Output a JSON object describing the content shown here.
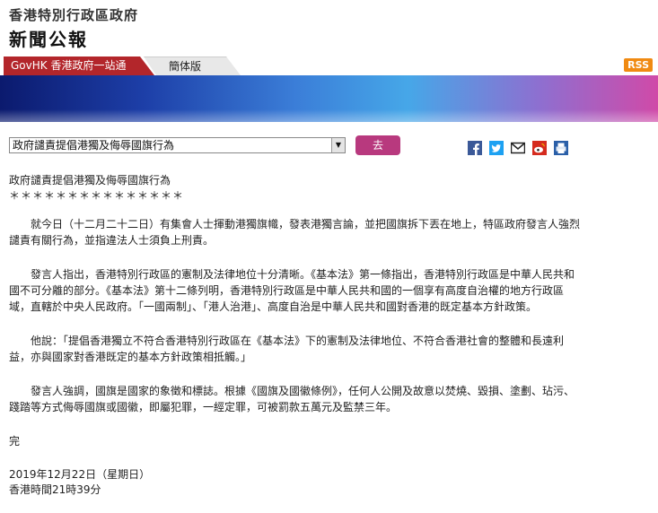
{
  "header": {
    "org": "香港特別行政區政府",
    "title": "新聞公報"
  },
  "tabs": {
    "govhk": "GovHK 香港政府一站通",
    "simplified": "簡体版"
  },
  "rss": "RSS",
  "select": {
    "value": "政府譴責提倡港獨及侮辱國旗行為"
  },
  "go_button": "去",
  "share_icons": [
    "facebook-icon",
    "twitter-icon",
    "email-icon",
    "weibo-icon",
    "print-icon"
  ],
  "article": {
    "title": "政府譴責提倡港獨及侮辱國旗行為",
    "stars": "＊＊＊＊＊＊＊＊＊＊＊＊＊＊＊",
    "paragraphs": [
      "就今日（十二月二十二日）有集會人士揮動港獨旗幟，發表港獨言論，並把國旗拆下丟在地上，特區政府發言人強烈譴責有關行為，並指違法人士須負上刑責。",
      "發言人指出，香港特別行政區的憲制及法律地位十分清晰。《基本法》第一條指出，香港特別行政區是中華人民共和國不可分離的部分。《基本法》第十二條列明，香港特別行政區是中華人民共和國的一個享有高度自治權的地方行政區域，直轄於中央人民政府。「一國兩制」、「港人治港」、高度自治是中華人民共和國對香港的既定基本方針政策。",
      "他說：「提倡香港獨立不符合香港特別行政區在《基本法》下的憲制及法律地位、不符合香港社會的整體和長遠利益，亦與國家對香港既定的基本方針政策相抵觸。」",
      "發言人強調，國旗是國家的象徵和標誌。根據《國旗及國徽條例》，任何人公開及故意以焚燒、毀損、塗劃、玷污、踐踏等方式侮辱國旗或國徽，即屬犯罪，一經定罪，可被罰款五萬元及監禁三年。"
    ],
    "end": "完",
    "date": "2019年12月22日（星期日）",
    "time": "香港時間21時39分"
  }
}
